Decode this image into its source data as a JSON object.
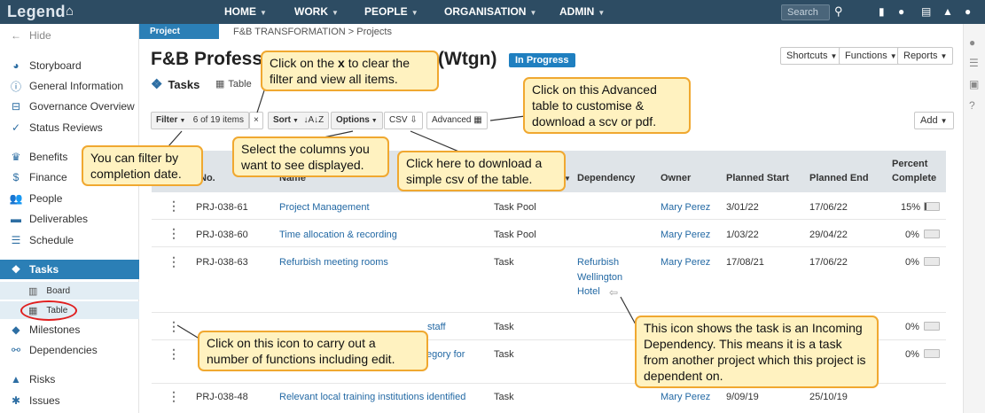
{
  "app": {
    "logo": "Legend",
    "home_icon": "home-icon"
  },
  "nav": [
    "HOME",
    "WORK",
    "PEOPLE",
    "ORGANISATION",
    "ADMIN"
  ],
  "search": {
    "placeholder": "Search"
  },
  "top_icons": [
    "bookmark-icon",
    "chat-icon",
    "document-icon",
    "bell-icon",
    "user-icon"
  ],
  "sidebar": {
    "hide": "Hide",
    "items": [
      "Storyboard",
      "General Information",
      "Governance Overview",
      "Status Reviews",
      "Benefits",
      "Finance",
      "People",
      "Deliverables",
      "Schedule",
      "Tasks",
      "Milestones",
      "Dependencies",
      "Risks",
      "Issues"
    ],
    "sub": [
      "Board",
      "Table"
    ]
  },
  "project": {
    "tab": "Project",
    "breadcrumb": "F&B TRANSFORMATION > Projects",
    "title_start": "F&B Profess",
    "title_end": "(Wtgn)",
    "status": "In Progress",
    "section": "Tasks",
    "view": "Table"
  },
  "header_buttons": {
    "shortcuts": "Shortcuts",
    "functions": "Functions",
    "reports": "Reports",
    "add": "Add"
  },
  "toolbar": {
    "filter": "Filter",
    "count": "6 of 19 items",
    "clear": "×",
    "sort": "Sort",
    "sort_icon": "↓A↓Z",
    "options": "Options",
    "csv": "CSV",
    "advanced": "Advanced"
  },
  "table": {
    "headers": {
      "no": "No.",
      "name": "Name",
      "dependency": "Dependency",
      "owner": "Owner",
      "planned_start": "Planned Start",
      "planned_end": "Planned End",
      "percent_1": "Percent",
      "percent_2": "Complete"
    },
    "rows": [
      {
        "no": "PRJ-038-61",
        "name": "Project Management",
        "type": "Task Pool",
        "dep": "",
        "owner": "Mary Perez",
        "start": "3/01/22",
        "end": "17/06/22",
        "pct": "15%",
        "pct_val": 0.15
      },
      {
        "no": "PRJ-038-60",
        "name": "Time allocation & recording",
        "type": "Task Pool",
        "dep": "",
        "owner": "Mary Perez",
        "start": "1/03/22",
        "end": "29/04/22",
        "pct": "0%",
        "pct_val": 0
      },
      {
        "no": "PRJ-038-63",
        "name": "Refurbish meeting rooms",
        "type": "Task",
        "dep": [
          "Refurbish",
          "Wellington",
          "Hotel"
        ],
        "owner": "Mary Perez",
        "start": "17/08/21",
        "end": "17/06/22",
        "pct": "0%",
        "pct_val": 0
      },
      {
        "no": "",
        "name": "staff",
        "type": "Task",
        "dep": "",
        "owner": "",
        "start": "",
        "end": "",
        "pct": "0%",
        "pct_val": 0
      },
      {
        "no": "",
        "name": "egory for",
        "type": "Task",
        "dep": "",
        "owner": "",
        "start": "",
        "end": "",
        "pct": "0%",
        "pct_val": 0
      },
      {
        "no": "PRJ-038-48",
        "name": "Relevant local training institutions identified",
        "type": "Task",
        "dep": "",
        "owner": "Mary Perez",
        "start": "9/09/19",
        "end": "25/10/19",
        "pct": "0%",
        "pct_val": 0
      }
    ]
  },
  "callouts": {
    "clear_filter_1": "Click on the ",
    "clear_filter_x": "x",
    "clear_filter_2": " to clear the filter and view all items.",
    "advanced": "Click on this Advanced table to customise & download a scv or pdf.",
    "filter": "You can filter by completion date.",
    "options": "Select the columns you want to see displayed.",
    "csv": "Click here to download a simple csv of the table.",
    "kebab": "Click on this icon to carry out a number of functions including edit.",
    "dependency": "This icon shows the task is an Incoming Dependency. This means it is a task from another project which this project is dependent on."
  },
  "colors": {
    "navbar": "#2d4c63",
    "accent": "#2b7fb6",
    "callout_bg": "#fff2c0",
    "callout_border": "#f0a830",
    "highlight": "#e01e1e"
  }
}
